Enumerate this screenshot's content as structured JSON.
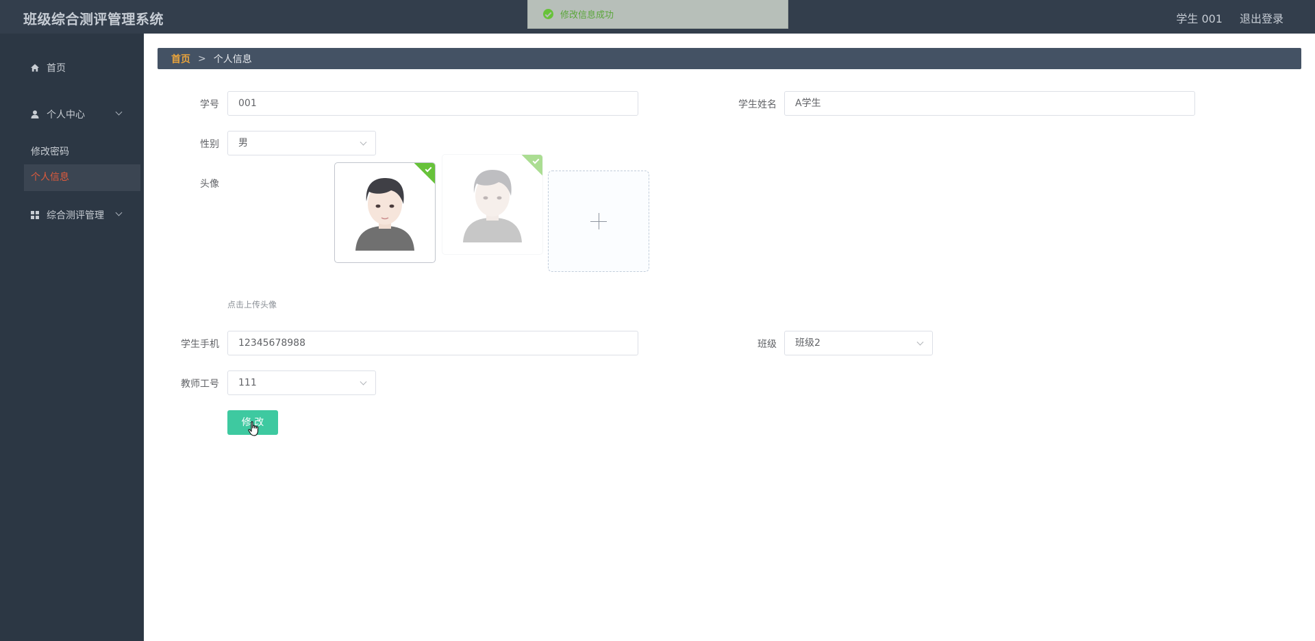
{
  "header": {
    "app_title": "班级综合测评管理系统",
    "user": "学生 001",
    "logout": "退出登录"
  },
  "toast": {
    "message": "修改信息成功",
    "type": "success"
  },
  "sidebar": {
    "home": "首页",
    "personal_center": "个人中心",
    "change_password": "修改密码",
    "personal_info": "个人信息",
    "evaluation_management": "综合测评管理"
  },
  "breadcrumb": {
    "home": "首页",
    "separator": ">",
    "current": "个人信息"
  },
  "form": {
    "student_id_label": "学号",
    "student_id_value": "001",
    "student_name_label": "学生姓名",
    "student_name_value": "A学生",
    "gender_label": "性别",
    "gender_value": "男",
    "avatar_label": "头像",
    "avatar_hint": "点击上传头像",
    "phone_label": "学生手机",
    "phone_value": "12345678988",
    "class_label": "班级",
    "class_value": "班级2",
    "teacher_id_label": "教师工号",
    "teacher_id_value": "111",
    "submit": "修 改"
  },
  "colors": {
    "topbar": "#333e4c",
    "sidebar": "#2c3744",
    "breadcrumb": "#445264",
    "active_menu_text": "#e05b3c",
    "primary_button": "#3ec9a0",
    "success": "#67c23a"
  },
  "icons": {
    "home": "home-icon",
    "user": "user-icon",
    "grid": "grid-icon",
    "check": "check-icon",
    "plus": "plus-icon"
  }
}
